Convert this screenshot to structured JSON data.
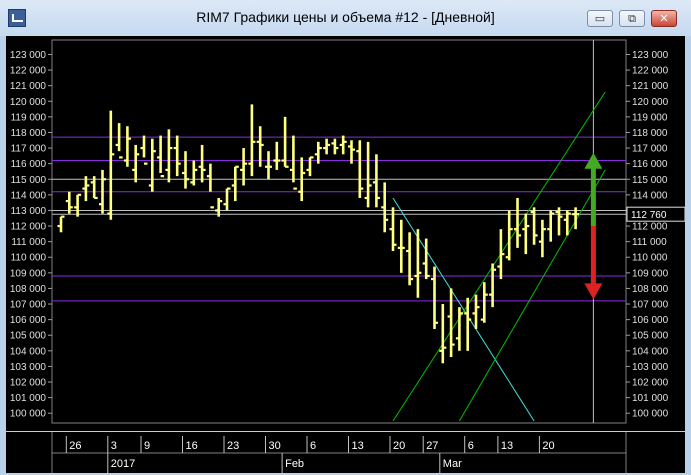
{
  "window": {
    "title": "RIM7 Графики цены и объема #12 - [Дневной]",
    "minimize_label": "▭",
    "restore_label": "⧉",
    "close_label": "✕"
  },
  "colors": {
    "background": "#000000",
    "bars": "#ffff80",
    "grid": "#404040",
    "level_lines": "#8a2be2",
    "white_lines": "#c0c0c0",
    "trend_down": "#40e0e0",
    "channel": "#00c000",
    "arrow_up": "#44aa22",
    "arrow_down": "#dd2222"
  },
  "chart_data": {
    "type": "ohlc",
    "title": "RIM7",
    "x": [
      "2016-12-23",
      "2016-12-26",
      "2016-12-27",
      "2016-12-28",
      "2016-12-29",
      "2016-12-30",
      "2017-01-03",
      "2017-01-04",
      "2017-01-05",
      "2017-01-06",
      "2017-01-09",
      "2017-01-10",
      "2017-01-11",
      "2017-01-12",
      "2017-01-13",
      "2017-01-16",
      "2017-01-17",
      "2017-01-18",
      "2017-01-19",
      "2017-01-20",
      "2017-01-23",
      "2017-01-24",
      "2017-01-25",
      "2017-01-26",
      "2017-01-27",
      "2017-01-30",
      "2017-01-31",
      "2017-02-01",
      "2017-02-02",
      "2017-02-03",
      "2017-02-06",
      "2017-02-07",
      "2017-02-08",
      "2017-02-09",
      "2017-02-10",
      "2017-02-13",
      "2017-02-14",
      "2017-02-15",
      "2017-02-16",
      "2017-02-17",
      "2017-02-20",
      "2017-02-21",
      "2017-02-22",
      "2017-02-24",
      "2017-02-27",
      "2017-02-28",
      "2017-03-01",
      "2017-03-02",
      "2017-03-03",
      "2017-03-06",
      "2017-03-07",
      "2017-03-09",
      "2017-03-10",
      "2017-03-13",
      "2017-03-14",
      "2017-03-15",
      "2017-03-16",
      "2017-03-17",
      "2017-03-20",
      "2017-03-21",
      "2017-03-22",
      "2017-03-23",
      "2017-03-24"
    ],
    "open": [
      112000,
      113600,
      113200,
      114400,
      114800,
      113400,
      112800,
      117200,
      116200,
      115600,
      117000,
      114600,
      116400,
      115600,
      117000,
      115400,
      114800,
      115800,
      115200,
      113000,
      113400,
      114600,
      115600,
      116000,
      117400,
      115800,
      116200,
      116200,
      115600,
      114200,
      115600,
      116600,
      117000,
      117300,
      117200,
      117100,
      116800,
      113800,
      114800,
      113200,
      111800,
      110600,
      110400,
      108800,
      109600,
      108600,
      104000,
      106200,
      104800,
      106400,
      106400,
      106000,
      107600,
      109400,
      110000,
      111800,
      111800,
      112900,
      111000,
      111800,
      112900,
      112400,
      112760
    ],
    "high": [
      112600,
      114200,
      114000,
      115200,
      115200,
      115600,
      119400,
      118600,
      118400,
      117200,
      117800,
      117600,
      117800,
      118200,
      117800,
      116800,
      116200,
      117200,
      116000,
      113800,
      114400,
      115800,
      117000,
      119800,
      118400,
      116800,
      117400,
      119000,
      117800,
      116400,
      116400,
      117400,
      117600,
      117600,
      117800,
      117500,
      117500,
      117400,
      116600,
      114800,
      113200,
      112400,
      111600,
      111800,
      111200,
      109400,
      107000,
      108000,
      106800,
      107400,
      107600,
      108400,
      109600,
      111800,
      113000,
      113800,
      112800,
      113200,
      112400,
      113000,
      113200,
      113000,
      113200
    ],
    "low": [
      111600,
      112800,
      112600,
      113600,
      113800,
      112800,
      112400,
      116800,
      115800,
      114800,
      116400,
      114200,
      115400,
      114800,
      115200,
      114400,
      114600,
      114800,
      114200,
      112600,
      113000,
      113600,
      114600,
      115200,
      115800,
      115000,
      115600,
      115800,
      114800,
      113600,
      115200,
      116000,
      116600,
      116600,
      116600,
      116000,
      113800,
      113200,
      113200,
      111600,
      110400,
      109000,
      108200,
      107400,
      108600,
      105400,
      103200,
      103600,
      104000,
      104000,
      105400,
      105800,
      106800,
      108600,
      109800,
      110600,
      110200,
      110800,
      110000,
      111000,
      111400,
      111400,
      111800
    ],
    "close": [
      112600,
      113200,
      114000,
      114600,
      113800,
      115000,
      116600,
      116400,
      117600,
      116600,
      116000,
      116800,
      115200,
      117000,
      116000,
      115000,
      115600,
      115600,
      113200,
      113600,
      114400,
      115800,
      116000,
      117400,
      117200,
      115800,
      116200,
      115800,
      114400,
      115400,
      116400,
      117000,
      117200,
      117000,
      117400,
      116900,
      114400,
      114600,
      113800,
      112400,
      110800,
      110600,
      108600,
      109000,
      108800,
      105800,
      104200,
      104400,
      106400,
      106000,
      106800,
      107600,
      109200,
      110200,
      111800,
      111400,
      112000,
      111400,
      111800,
      112800,
      112600,
      112800,
      112760
    ]
  },
  "price_axis": {
    "min": 99500,
    "max": 123800,
    "ticks": [
      "123 000",
      "122 000",
      "121 000",
      "120 000",
      "119 000",
      "118 000",
      "117 000",
      "116 000",
      "115 000",
      "114 000",
      "113 000",
      "112 000",
      "111 000",
      "110 000",
      "109 000",
      "108 000",
      "107 000",
      "106 000",
      "105 000",
      "104 000",
      "103 000",
      "102 000",
      "101 000",
      "100 000"
    ],
    "tick_values": [
      123000,
      122000,
      121000,
      120000,
      119000,
      118000,
      117000,
      116000,
      115000,
      114000,
      113000,
      112000,
      111000,
      110000,
      109000,
      108000,
      107000,
      106000,
      105000,
      104000,
      103000,
      102000,
      101000,
      100000
    ],
    "last_price_label": "112 760",
    "last_price": 112760
  },
  "levels": {
    "purple": [
      117700,
      116200,
      114200,
      108800,
      107200
    ],
    "white": [
      115000,
      113000,
      112760
    ]
  },
  "time_axis": {
    "day_labels": [
      {
        "text": "26",
        "date": "2016-12-26"
      },
      {
        "text": "3",
        "date": "2017-01-03"
      },
      {
        "text": "9",
        "date": "2017-01-09"
      },
      {
        "text": "16",
        "date": "2017-01-16"
      },
      {
        "text": "23",
        "date": "2017-01-23"
      },
      {
        "text": "30",
        "date": "2017-01-30"
      },
      {
        "text": "6",
        "date": "2017-02-06"
      },
      {
        "text": "13",
        "date": "2017-02-13"
      },
      {
        "text": "20",
        "date": "2017-02-20"
      },
      {
        "text": "27",
        "date": "2017-02-27"
      },
      {
        "text": "6",
        "date": "2017-03-06"
      },
      {
        "text": "13",
        "date": "2017-03-13"
      },
      {
        "text": "20",
        "date": "2017-03-20"
      }
    ],
    "month_labels": [
      {
        "text": "2017",
        "date": "2017-01-03"
      },
      {
        "text": "Feb",
        "date": "2017-02-01"
      },
      {
        "text": "Mar",
        "date": "2017-03-01"
      }
    ]
  },
  "cursor_date": "2017-03-27",
  "trendlines": [
    {
      "kind": "trend_down",
      "from": {
        "date": "2017-02-20",
        "price": 113800
      },
      "to": {
        "date": "2017-03-17",
        "price": 99500
      }
    },
    {
      "kind": "channel",
      "from": {
        "date": "2017-02-20",
        "price": 99500
      },
      "to": {
        "date": "2017-03-29",
        "price": 120600
      }
    },
    {
      "kind": "channel",
      "from": {
        "date": "2017-03-03",
        "price": 99500
      },
      "to": {
        "date": "2017-03-29",
        "price": 115600
      }
    }
  ],
  "arrows": [
    {
      "kind": "arrow_up",
      "date": "2017-03-27",
      "from_price": 112000,
      "to_price": 116700
    },
    {
      "kind": "arrow_down",
      "date": "2017-03-27",
      "from_price": 112000,
      "to_price": 107300
    }
  ]
}
